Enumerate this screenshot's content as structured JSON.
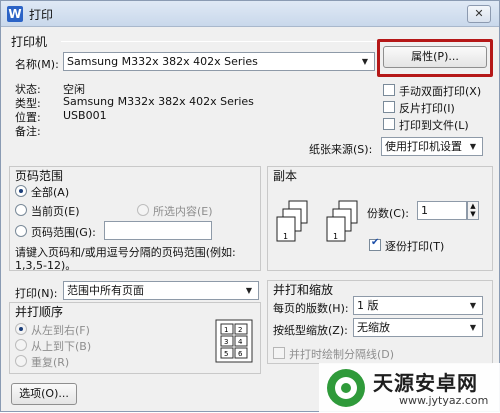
{
  "titlebar": {
    "app_icon": "W",
    "title": "打印",
    "close": "✕"
  },
  "printer": {
    "group_title": "打印机",
    "name_label": "名称(M):",
    "name_value": "Samsung M332x 382x 402x Series",
    "properties_button": "属性(P)...",
    "status_label": "状态:",
    "status_value": "空闲",
    "type_label": "类型:",
    "type_value": "Samsung M332x 382x 402x Series",
    "location_label": "位置:",
    "location_value": "USB001",
    "comment_label": "备注:",
    "duplex_label": "手动双面打印(X)",
    "reverse_label": "反片打印(I)",
    "to_file_label": "打印到文件(L)",
    "paper_source_label": "纸张来源(S):",
    "paper_source_value": "使用打印机设置"
  },
  "page_range": {
    "group_title": "页码范围",
    "all_label": "全部(A)",
    "current_label": "当前页(E)",
    "selection_label": "所选内容(E)",
    "pages_label": "页码范围(G):",
    "pages_value": "",
    "hint_line1": "请键入页码和/或用逗号分隔的页码范围(例如:",
    "hint_line2": "1,3,5-12)。"
  },
  "copies": {
    "group_title": "副本",
    "count_label": "份数(C):",
    "count_value": "1",
    "collate_label": "逐份打印(T)",
    "stack_labels": [
      "3",
      "2",
      "1",
      "3",
      "2",
      "1"
    ]
  },
  "print_what": {
    "label": "打印(N):",
    "value": "范围中所有页面"
  },
  "order": {
    "group_title": "并打顺序",
    "left_to_right": "从左到右(F)",
    "top_to_bottom": "从上到下(B)",
    "repeat": "重复(R)",
    "grid_cells": [
      "1",
      "2",
      "3",
      "4",
      "5",
      "6"
    ]
  },
  "zoom": {
    "group_title": "并打和缩放",
    "pages_per_sheet_label": "每页的版数(H):",
    "pages_per_sheet_value": "1 版",
    "scale_label": "按纸型缩放(Z):",
    "scale_value": "无缩放",
    "draw_borders_label": "并打时绘制分隔线(D)"
  },
  "footer": {
    "options_button": "选项(O)..."
  },
  "watermark": {
    "title": "天源安卓网",
    "url": "www.jytyaz.com"
  },
  "colors": {
    "highlight": "#b51818",
    "accent": "#1d4ea8",
    "watermark_green": "#2f9a3a"
  }
}
